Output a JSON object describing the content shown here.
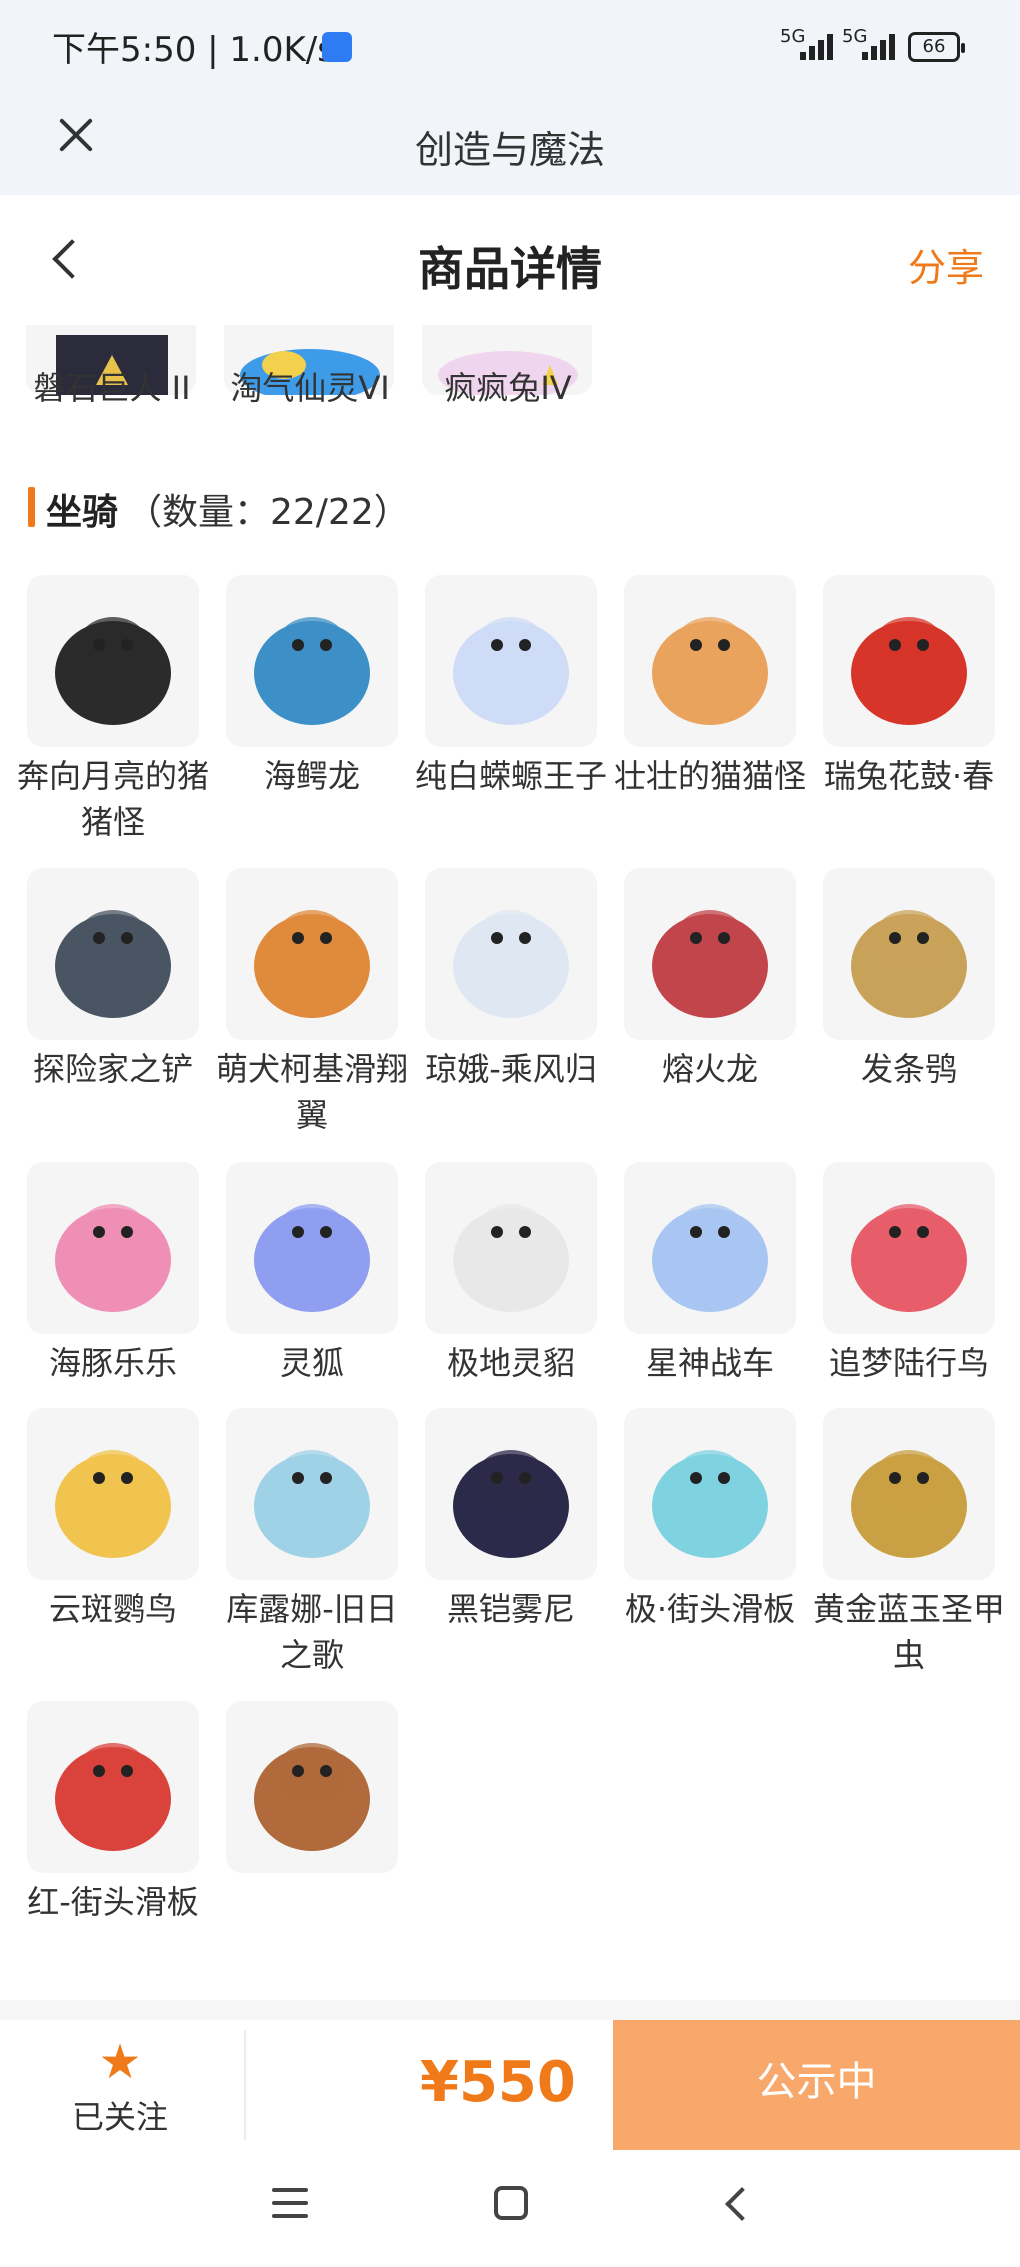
{
  "status_bar": {
    "time": "下午5:50 | 1.0K/s",
    "network_1": "5G",
    "network_2": "5G",
    "battery": "66"
  },
  "app_bar": {
    "title": "创造与魔法"
  },
  "nav_bar": {
    "title": "商品详情",
    "share_label": "分享"
  },
  "previous_section": {
    "items": [
      {
        "name": "磐石巨人 II"
      },
      {
        "name": "淘气仙灵VI"
      },
      {
        "name": "疯疯兔IV"
      }
    ]
  },
  "mounts": {
    "label": "坐骑",
    "count": "（数量：22/22）",
    "items": [
      {
        "name": "奔向月亮的猪猪怪",
        "icon": "pig-mount-icon",
        "color": "#2b2b2b"
      },
      {
        "name": "海鳄龙",
        "icon": "sea-dragon-icon",
        "color": "#3c8fc7"
      },
      {
        "name": "纯白蝾螈王子",
        "icon": "axolotl-icon",
        "color": "#cfdcf7"
      },
      {
        "name": "壮壮的猫猫怪",
        "icon": "cat-mount-icon",
        "color": "#e9a35d"
      },
      {
        "name": "瑞兔花鼓·春",
        "icon": "drum-icon",
        "color": "#d7342a"
      },
      {
        "name": "探险家之铲",
        "icon": "shovel-icon",
        "color": "#4a5563"
      },
      {
        "name": "萌犬柯基滑翔翼",
        "icon": "corgi-glider-icon",
        "color": "#e08a3c"
      },
      {
        "name": "琼娥-乘风归",
        "icon": "fairy-icon",
        "color": "#dfe7f2"
      },
      {
        "name": "熔火龙",
        "icon": "fire-dragon-icon",
        "color": "#c2454b"
      },
      {
        "name": "发条鸮",
        "icon": "clockwork-owl-icon",
        "color": "#c9a25a"
      },
      {
        "name": "海豚乐乐",
        "icon": "dolphin-icon",
        "color": "#ef8fb6"
      },
      {
        "name": "灵狐",
        "icon": "spirit-fox-icon",
        "color": "#8f9ef0"
      },
      {
        "name": "极地灵貂",
        "icon": "polar-marten-icon",
        "color": "#e8e8e8"
      },
      {
        "name": "星神战车",
        "icon": "star-chariot-icon",
        "color": "#a9c6f2"
      },
      {
        "name": "追梦陆行鸟",
        "icon": "dream-bird-icon",
        "color": "#e75d6a"
      },
      {
        "name": "云斑鹦鸟",
        "icon": "parrot-icon",
        "color": "#f0c44f"
      },
      {
        "name": "库露娜-旧日之歌",
        "icon": "kuluna-icon",
        "color": "#9fd2e6"
      },
      {
        "name": "黑铠雾尼",
        "icon": "black-armor-icon",
        "color": "#2c2a4a"
      },
      {
        "name": "极·街头滑板",
        "icon": "skateboard-icon",
        "color": "#7fd3e0"
      },
      {
        "name": "黄金蓝玉圣甲虫",
        "icon": "scarab-icon",
        "color": "#c9a043"
      },
      {
        "name": "红-街头滑板",
        "icon": "red-skateboard-icon",
        "color": "#d9433c"
      },
      {
        "name": "",
        "icon": "capybara-icon",
        "color": "#b06a3b"
      }
    ]
  },
  "bottom_bar": {
    "follow_label": "已关注",
    "price": "¥550",
    "status_label": "公示中"
  },
  "colors": {
    "accent": "#f07a1a",
    "button_bg": "#f9a86c",
    "header_bg": "#f1f4f8"
  }
}
